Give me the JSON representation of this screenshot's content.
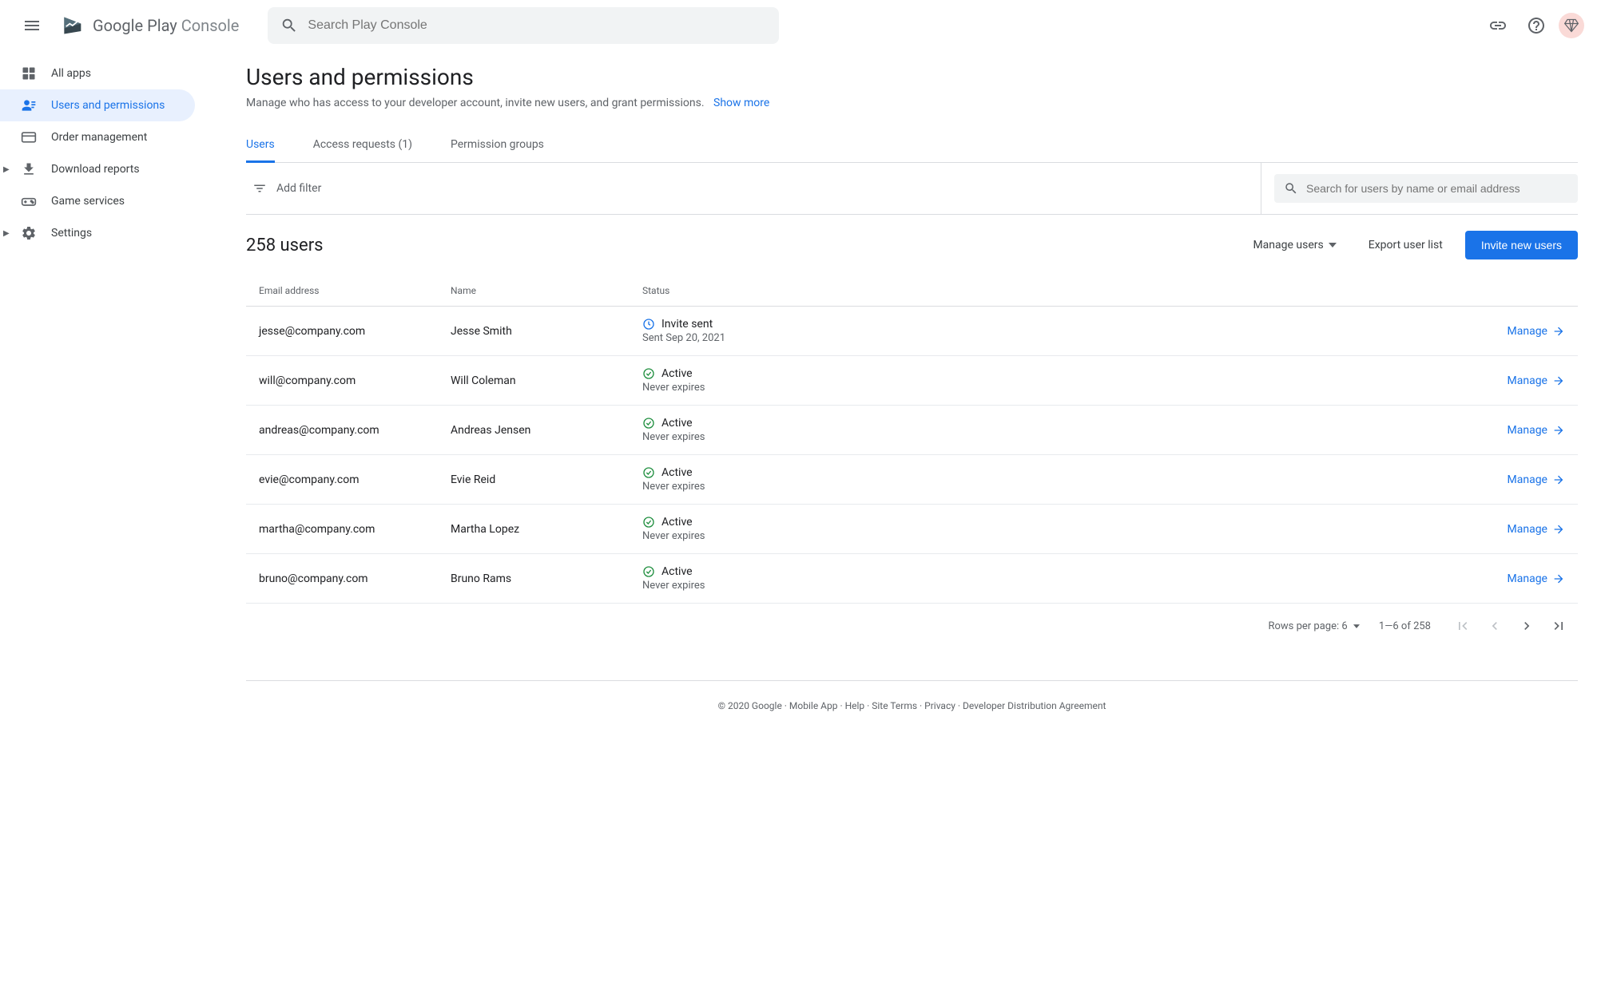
{
  "header": {
    "logo_text_1": "Google Play ",
    "logo_text_2": "Console",
    "search_placeholder": "Search Play Console"
  },
  "sidebar": {
    "items": [
      {
        "label": "All apps",
        "expandable": false
      },
      {
        "label": "Users and permissions",
        "expandable": false
      },
      {
        "label": "Order management",
        "expandable": false
      },
      {
        "label": "Download reports",
        "expandable": true
      },
      {
        "label": "Game services",
        "expandable": false
      },
      {
        "label": "Settings",
        "expandable": true
      }
    ]
  },
  "page": {
    "title": "Users and permissions",
    "subtitle": "Manage who has access to your developer account, invite new users, and grant permissions.",
    "show_more": "Show more"
  },
  "tabs": [
    {
      "label": "Users"
    },
    {
      "label": "Access requests (1)"
    },
    {
      "label": "Permission groups"
    }
  ],
  "filter": {
    "add_filter": "Add filter",
    "search_placeholder": "Search for users by name or email address"
  },
  "list_header": {
    "count_label": "258 users",
    "manage_users": "Manage users",
    "export": "Export user list",
    "invite": "Invite new users"
  },
  "table": {
    "columns": {
      "email": "Email address",
      "name": "Name",
      "status": "Status"
    },
    "manage_label": "Manage",
    "rows": [
      {
        "email": "jesse@company.com",
        "name": "Jesse Smith",
        "status": "Invite sent",
        "status_sub": "Sent Sep 20, 2021",
        "status_type": "pending"
      },
      {
        "email": "will@company.com",
        "name": "Will Coleman",
        "status": "Active",
        "status_sub": "Never expires",
        "status_type": "active"
      },
      {
        "email": "andreas@company.com",
        "name": "Andreas Jensen",
        "status": "Active",
        "status_sub": "Never expires",
        "status_type": "active"
      },
      {
        "email": "evie@company.com",
        "name": "Evie Reid",
        "status": "Active",
        "status_sub": "Never expires",
        "status_type": "active"
      },
      {
        "email": "martha@company.com",
        "name": "Martha Lopez",
        "status": "Active",
        "status_sub": "Never expires",
        "status_type": "active"
      },
      {
        "email": "bruno@company.com",
        "name": "Bruno Rams",
        "status": "Active",
        "status_sub": "Never expires",
        "status_type": "active"
      }
    ]
  },
  "pagination": {
    "rows_per_page": "Rows per page: 6",
    "range": "1—6 of 258"
  },
  "footer": {
    "copyright": "© 2020 Google",
    "links": [
      "Mobile App",
      "Help",
      "Site Terms",
      "Privacy",
      "Developer Distribution Agreement"
    ]
  }
}
